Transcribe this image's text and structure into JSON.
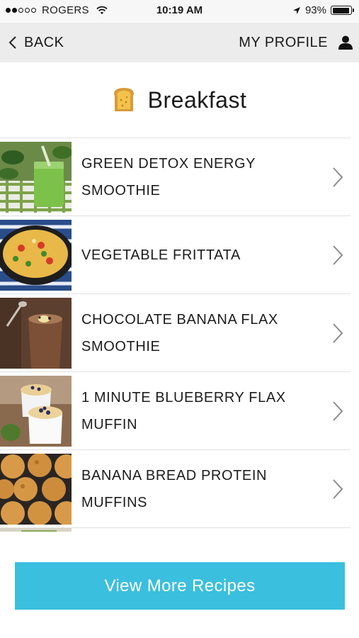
{
  "status_bar": {
    "carrier": "ROGERS",
    "time": "10:19 AM",
    "battery_percent": "93%",
    "battery_level": 0.93,
    "signal_bars_filled": 2,
    "signal_bars_total": 5,
    "icons": [
      "wifi-icon",
      "location-arrow-icon",
      "battery-icon"
    ]
  },
  "nav": {
    "back_label": "BACK",
    "profile_label": "MY PROFILE",
    "icons": [
      "chevron-left-icon",
      "person-icon"
    ]
  },
  "page": {
    "title": "Breakfast",
    "title_icon": "toast-icon"
  },
  "recipes": [
    {
      "line1": "GREEN DETOX ENERGY",
      "line2": "SMOOTHIE",
      "image": "green-smoothie"
    },
    {
      "line1": "VEGETABLE FRITTATA",
      "line2": "",
      "image": "frittata"
    },
    {
      "line1": "CHOCOLATE BANANA FLAX",
      "line2": "SMOOTHIE",
      "image": "chocolate-smoothie"
    },
    {
      "line1": "1 MINUTE BLUEBERRY FLAX",
      "line2": "MUFFIN",
      "image": "blueberry-muffin"
    },
    {
      "line1": "BANANA BREAD PROTEIN",
      "line2": "MUFFINS",
      "image": "banana-muffins"
    }
  ],
  "button": {
    "label": "View More Recipes",
    "color": "#3bbfde"
  }
}
